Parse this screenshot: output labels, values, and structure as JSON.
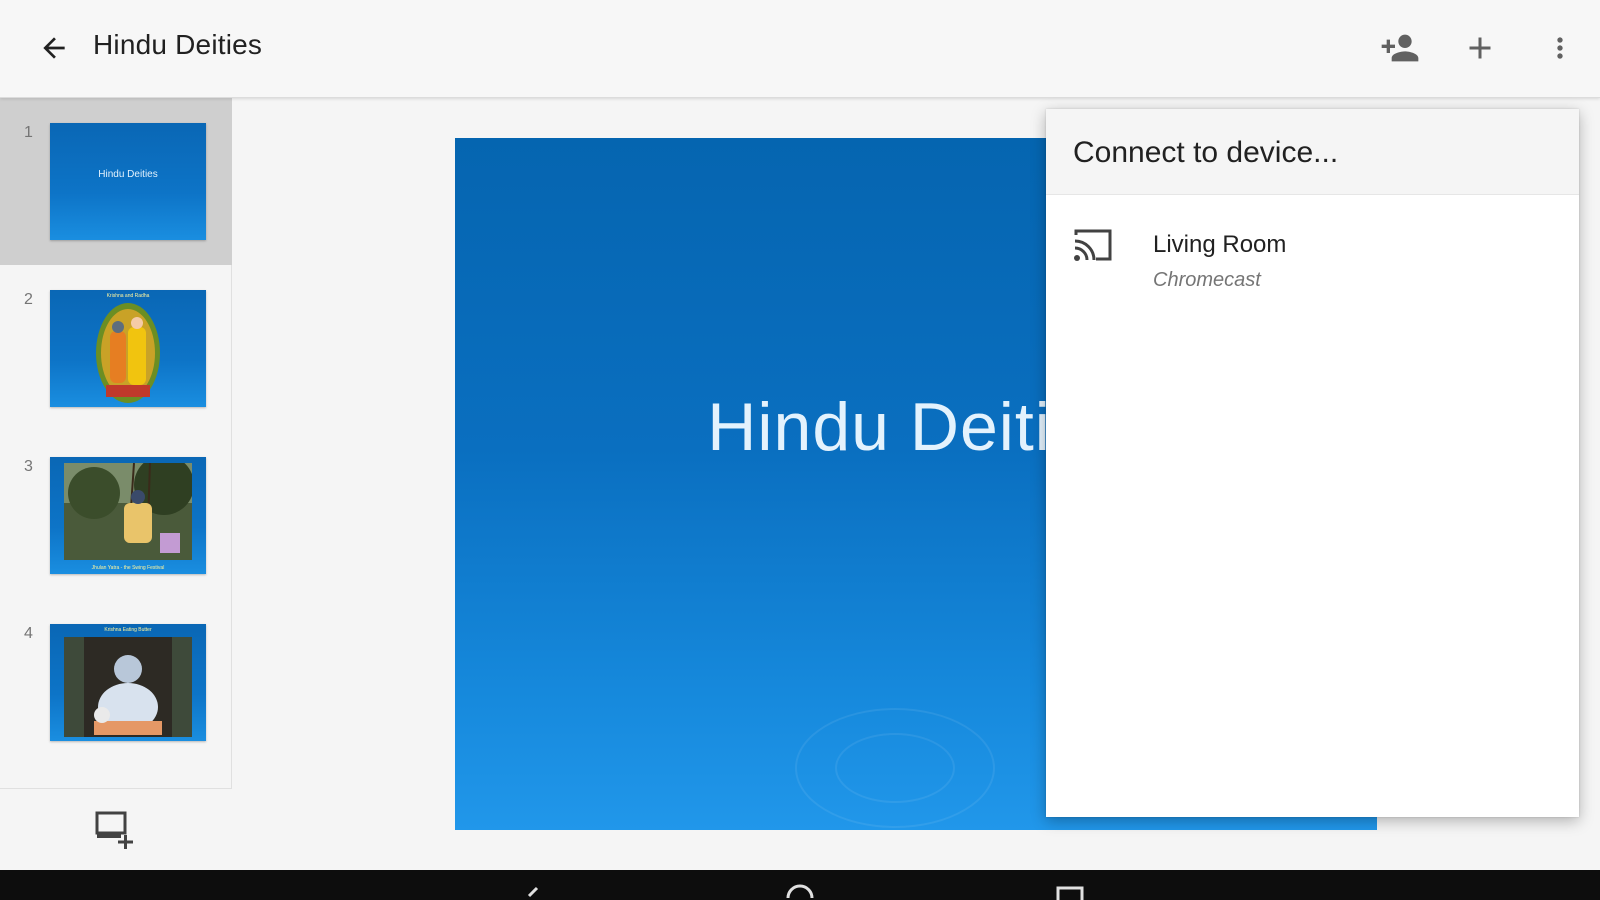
{
  "header": {
    "title": "Hindu Deities",
    "back_icon": "arrow-left-icon",
    "share_icon": "person-add-icon",
    "add_icon": "plus-icon",
    "menu_icon": "more-vert-icon"
  },
  "sidebar": {
    "slides": [
      {
        "number": "1",
        "title": "Hindu Deities",
        "selected": true
      },
      {
        "number": "2",
        "caption": "Krishna and Radha",
        "selected": false
      },
      {
        "number": "3",
        "caption": "Jhulan Yatra - the Swing Festival",
        "selected": false
      },
      {
        "number": "4",
        "caption": "Krishna Eating Butter",
        "selected": false
      }
    ],
    "add_slide_icon": "add-slide-icon"
  },
  "slide": {
    "title": "Hindu Deities"
  },
  "cast_dialog": {
    "title": "Connect to device...",
    "devices": [
      {
        "name": "Living Room",
        "type": "Chromecast",
        "icon": "cast-icon"
      }
    ]
  },
  "colors": {
    "slide_blue": "#0a6fc0",
    "topbar": "#f7f7f7",
    "selected_slide": "#cfcfcf"
  }
}
